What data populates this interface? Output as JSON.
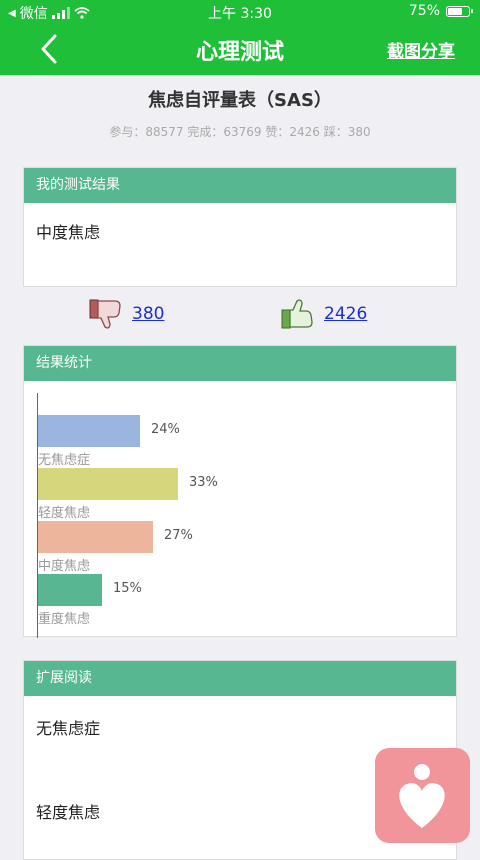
{
  "status": {
    "carrier": "微信",
    "time": "上午 3:30",
    "battery": "75%",
    "battery_level": 0.75
  },
  "nav": {
    "title": "心理测试",
    "share": "截图分享"
  },
  "test": {
    "title": "焦虑自评量表（SAS）",
    "stats": "参与：88577 完成：63769 赞：2426 踩：380"
  },
  "result": {
    "header": "我的测试结果",
    "text": "中度焦虑"
  },
  "votes": {
    "dislike": "380",
    "like": "2426"
  },
  "stats_section": {
    "header": "结果统计"
  },
  "chart_data": {
    "type": "bar",
    "orientation": "horizontal",
    "categories": [
      "无焦虑症",
      "轻度焦虑",
      "中度焦虑",
      "重度焦虑"
    ],
    "values": [
      24,
      33,
      27,
      15
    ],
    "value_labels": [
      "24%",
      "33%",
      "27%",
      "15%"
    ],
    "colors": [
      "#9cb5e0",
      "#d6d77d",
      "#edb59b",
      "#58b692"
    ],
    "title": "",
    "xlabel": "",
    "ylabel": "",
    "grid": false
  },
  "reading": {
    "header": "扩展阅读",
    "items": [
      "无焦虑症",
      "轻度焦虑"
    ]
  },
  "colors": {
    "primary": "#1fbf3a",
    "section_header": "#56b791",
    "link": "#1a2fd6",
    "logo": "#f1959b"
  }
}
